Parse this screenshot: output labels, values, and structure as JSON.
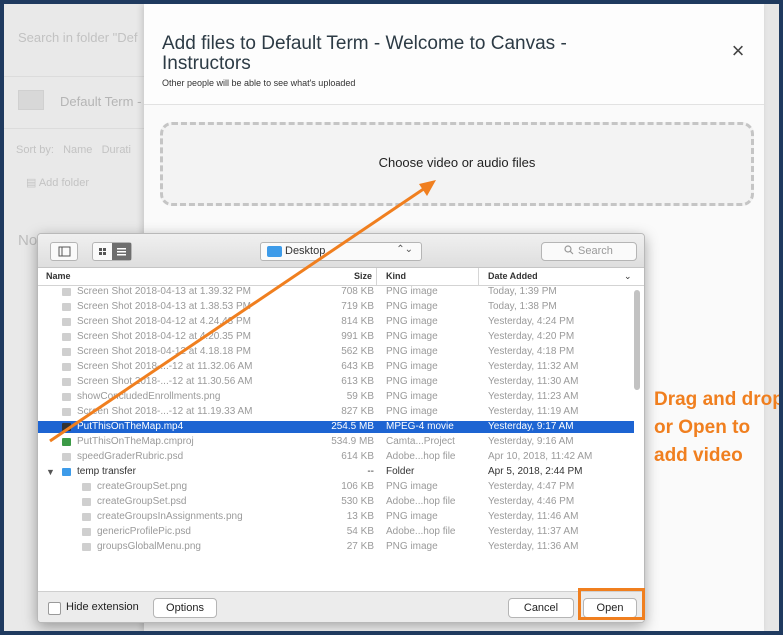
{
  "background": {
    "search_text": "Search in folder \"Def",
    "term": "Default Term -",
    "sort_label": "Sort by:",
    "sort_name": "Name",
    "sort_duration": "Durati",
    "add_folder": "Add folder",
    "no_text": "No"
  },
  "modal": {
    "title": "Add files to Default Term - Welcome to Canvas - Instructors",
    "subtitle": "Other people will be able to see what's uploaded",
    "close_glyph": "×",
    "dropzone_label": "Choose video or audio files"
  },
  "dialog": {
    "location": "Desktop",
    "location_arrows": "⌃⌄",
    "search_icon": "🔍",
    "search_placeholder": "Search",
    "columns": {
      "name": "Name",
      "size": "Size",
      "kind": "Kind",
      "date": "Date Added"
    },
    "rows": [
      {
        "name": "Screen Shot 2018-04-13 at 1.39.32 PM",
        "size": "708 KB",
        "kind": "PNG image",
        "date": "Today, 1:39 PM",
        "state": "dim"
      },
      {
        "name": "Screen Shot 2018-04-13 at 1.38.53 PM",
        "size": "719 KB",
        "kind": "PNG image",
        "date": "Today, 1:38 PM",
        "state": "dim"
      },
      {
        "name": "Screen Shot 2018-04-12 at 4.24.43 PM",
        "size": "814 KB",
        "kind": "PNG image",
        "date": "Yesterday, 4:24 PM",
        "state": "dim"
      },
      {
        "name": "Screen Shot 2018-04-12 at 4.20.35 PM",
        "size": "991 KB",
        "kind": "PNG image",
        "date": "Yesterday, 4:20 PM",
        "state": "dim"
      },
      {
        "name": "Screen Shot 2018-04-12 at 4.18.18 PM",
        "size": "562 KB",
        "kind": "PNG image",
        "date": "Yesterday, 4:18 PM",
        "state": "dim"
      },
      {
        "name": "Screen Shot 2018-...-12 at 11.32.06 AM",
        "size": "643 KB",
        "kind": "PNG image",
        "date": "Yesterday, 11:32 AM",
        "state": "dim"
      },
      {
        "name": "Screen Shot 2018-...-12 at 11.30.56 AM",
        "size": "613 KB",
        "kind": "PNG image",
        "date": "Yesterday, 11:30 AM",
        "state": "dim"
      },
      {
        "name": "showConcludedEnrollments.png",
        "size": "59 KB",
        "kind": "PNG image",
        "date": "Yesterday, 11:23 AM",
        "state": "dim"
      },
      {
        "name": "Screen Shot 2018-...-12 at 11.19.33 AM",
        "size": "827 KB",
        "kind": "PNG image",
        "date": "Yesterday, 11:19 AM",
        "state": "dim"
      },
      {
        "name": "PutThisOnTheMap.mp4",
        "size": "254.5 MB",
        "kind": "MPEG-4 movie",
        "date": "Yesterday, 9:17 AM",
        "state": "sel"
      },
      {
        "name": "PutThisOnTheMap.cmproj",
        "size": "534.9 MB",
        "kind": "Camta...Project",
        "date": "Yesterday, 9:16 AM",
        "state": "dim"
      },
      {
        "name": "speedGraderRubric.psd",
        "size": "614 KB",
        "kind": "Adobe...hop file",
        "date": "Apr 10, 2018, 11:42 AM",
        "state": "dim"
      },
      {
        "name": "temp transfer",
        "size": "--",
        "kind": "Folder",
        "date": "Apr 5, 2018, 2:44 PM",
        "state": "folder"
      },
      {
        "name": "createGroupSet.png",
        "size": "106 KB",
        "kind": "PNG image",
        "date": "Yesterday, 4:47 PM",
        "state": "dim"
      },
      {
        "name": "createGroupSet.psd",
        "size": "530 KB",
        "kind": "Adobe...hop file",
        "date": "Yesterday, 4:46 PM",
        "state": "dim"
      },
      {
        "name": "createGroupsInAssignments.png",
        "size": "13 KB",
        "kind": "PNG image",
        "date": "Yesterday, 11:46 AM",
        "state": "dim"
      },
      {
        "name": "genericProfilePic.psd",
        "size": "54 KB",
        "kind": "Adobe...hop file",
        "date": "Yesterday, 11:37 AM",
        "state": "dim"
      },
      {
        "name": "groupsGlobalMenu.png",
        "size": "27 KB",
        "kind": "PNG image",
        "date": "Yesterday, 11:36 AM",
        "state": "dim"
      }
    ],
    "hide_extension": "Hide extension",
    "options": "Options",
    "cancel": "Cancel",
    "open": "Open"
  },
  "annotation": {
    "text": "Drag and drop or Open to add video",
    "color": "#f07f1f"
  },
  "colors": {
    "accent": "#f07f1f",
    "selection": "#1d64d2",
    "folder": "#3d9be9"
  }
}
